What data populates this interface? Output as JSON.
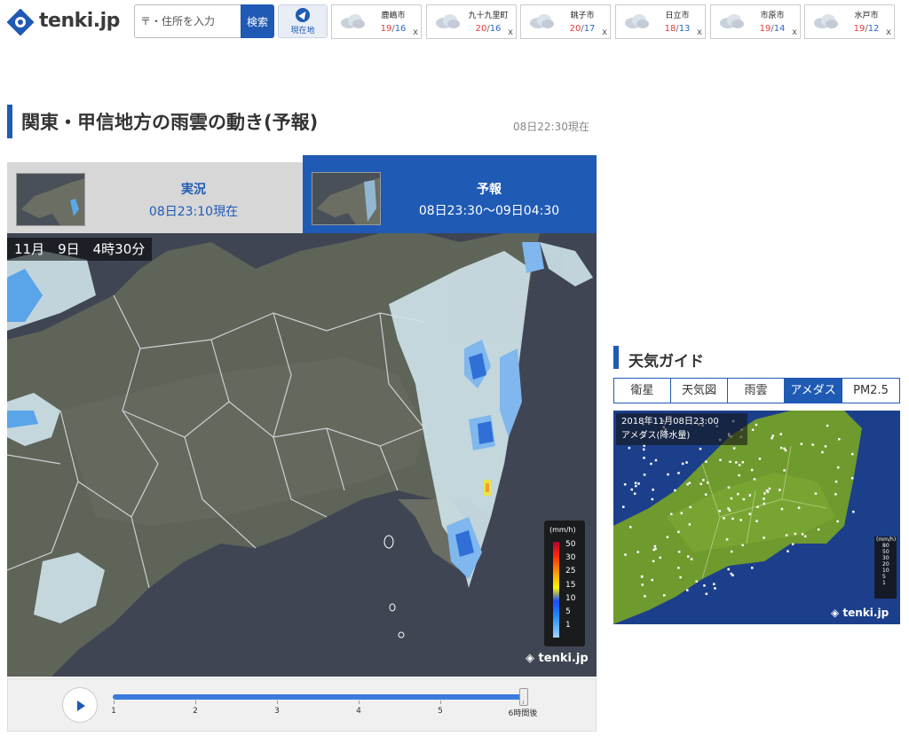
{
  "header": {
    "logo_text": "tenki.jp",
    "search_placeholder": "〒・住所を入力",
    "search_button": "検索",
    "location_button": "現在地",
    "cities": [
      {
        "name": "鹿嶋市",
        "high": "19",
        "low": "16"
      },
      {
        "name": "九十九里町",
        "high": "20",
        "low": "16"
      },
      {
        "name": "銚子市",
        "high": "20",
        "low": "17"
      },
      {
        "name": "日立市",
        "high": "18",
        "low": "13"
      },
      {
        "name": "市原市",
        "high": "19",
        "low": "14"
      },
      {
        "name": "水戸市",
        "high": "19",
        "low": "12"
      }
    ],
    "temp_separator": "/",
    "close_label": "x"
  },
  "main": {
    "title": "関東・甲信地方の雨雲の動き(予報)",
    "updated": "08日22:30現在",
    "tabs": [
      {
        "label": "実況",
        "time": "08日23:10現在",
        "active": false
      },
      {
        "label": "予報",
        "time": "08日23:30～09日04:30",
        "active": true
      }
    ],
    "map_time": "11月　9日　4時30分",
    "legend": {
      "unit": "(mm/h)",
      "values": [
        "50",
        "30",
        "25",
        "15",
        "10",
        "5",
        "1"
      ]
    },
    "brand": "tenki.jp",
    "player": {
      "ticks": [
        "1",
        "2",
        "3",
        "4",
        "5",
        "6時間後"
      ],
      "progress": 1.0
    }
  },
  "guide": {
    "title": "天気ガイド",
    "tabs": [
      {
        "label": "衛星",
        "active": false
      },
      {
        "label": "天気図",
        "active": false
      },
      {
        "label": "雨雲",
        "active": false
      },
      {
        "label": "アメダス",
        "active": true
      },
      {
        "label": "PM2.5",
        "active": false
      }
    ],
    "caption_line1": "2018年11月08日23:00",
    "caption_line2": "アメダス(降水量)",
    "legend": {
      "unit": "(mm/h)",
      "values": [
        "80",
        "50",
        "30",
        "20",
        "10",
        "5",
        "1"
      ]
    },
    "brand": "tenki.jp"
  },
  "colors": {
    "accent": "#1f5ab4",
    "temp_high": "#e03a3a",
    "temp_low": "#2a67c9"
  }
}
